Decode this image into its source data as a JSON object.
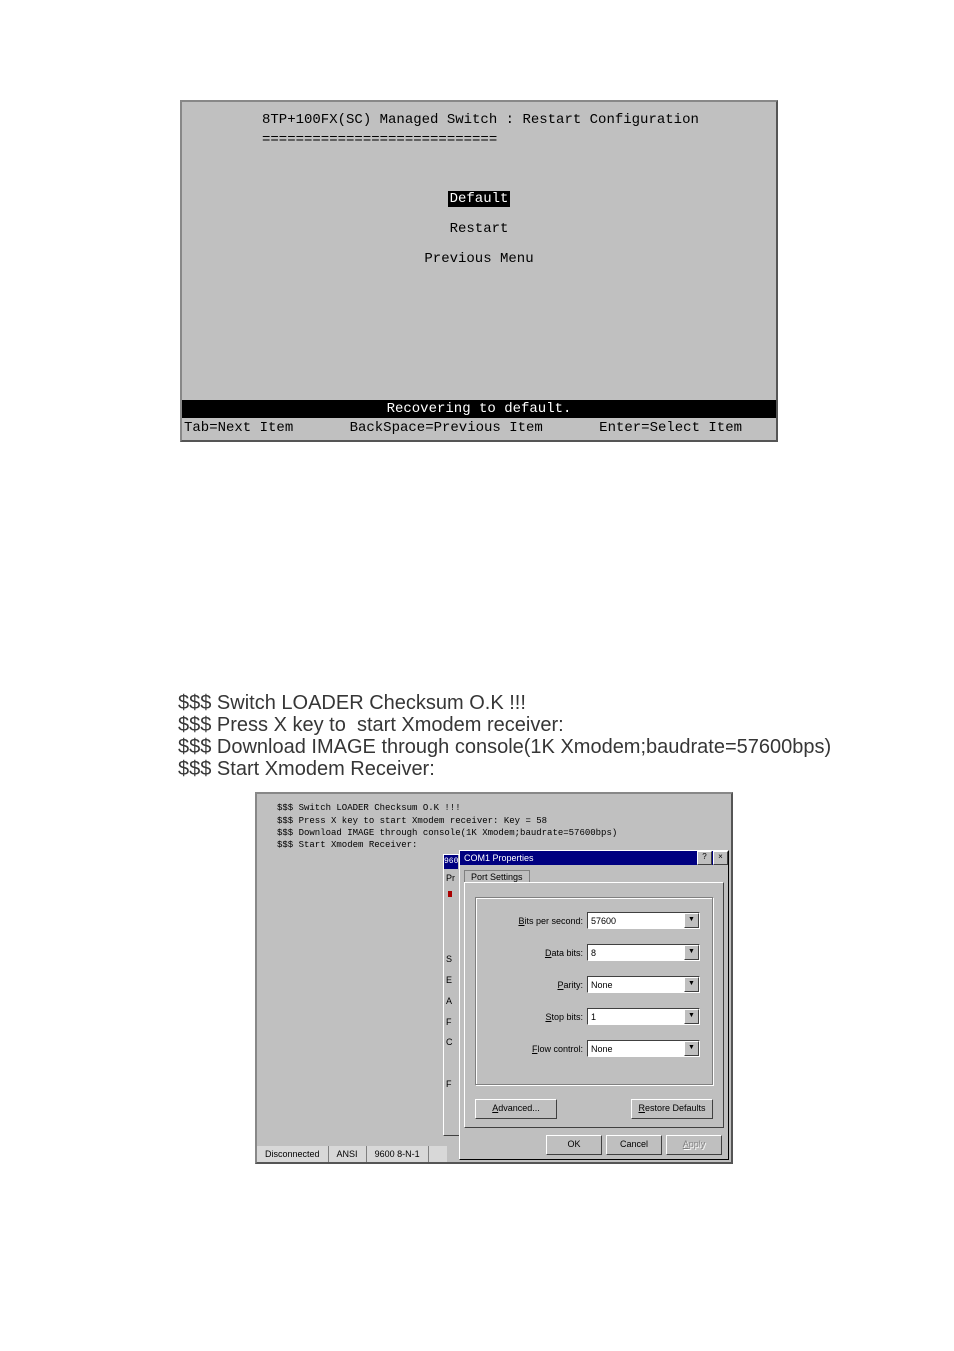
{
  "terminal1": {
    "title": "8TP+100FX(SC) Managed Switch : Restart Configuration",
    "underline": "============================",
    "menu": {
      "selected": "Default",
      "item2": "Restart",
      "item3": "Previous Menu"
    },
    "status": "Recovering to default.",
    "bottom": {
      "left": "Tab=Next Item",
      "mid": "BackSpace=Previous Item",
      "right": "Enter=Select Item"
    }
  },
  "mid_text": {
    "l1": "$$$ Switch LOADER Checksum O.K !!!",
    "l2": "$$$ Press X key to  start Xmodem receiver:",
    "l3": "$$$ Download IMAGE through console(1K Xmodem;baudrate=57600bps)",
    "l4": "$$$ Start Xmodem Receiver:"
  },
  "terminal2": {
    "lines": {
      "l1": "$$$ Switch LOADER Checksum O.K !!!",
      "l2": "$$$ Press X key to  start Xmodem receiver: Key = 58",
      "l3": "$$$ Download IMAGE through console(1K Xmodem;baudrate=57600bps)",
      "l4": "$$$ Start Xmodem Receiver:"
    },
    "hidden_win": {
      "pr": "Pr",
      "letters": "S\nE\nA\nF\nC\n\nF"
    },
    "status": {
      "c1": "Disconnected",
      "c2": "ANSI",
      "c3": "9600 8-N-1"
    }
  },
  "dialog": {
    "title": "COM1 Properties",
    "title_prefix": "960",
    "help_btn": "?",
    "close_btn": "×",
    "tab": "Port Settings",
    "fields": {
      "bits_per_second": {
        "label_u": "B",
        "label_rest": "its per second:",
        "value": "57600"
      },
      "data_bits": {
        "label_u": "D",
        "label_rest": "ata bits:",
        "value": "8"
      },
      "parity": {
        "label_u": "P",
        "label_rest": "arity:",
        "value": "None"
      },
      "stop_bits": {
        "label_u": "S",
        "label_rest": "top bits:",
        "value": "1"
      },
      "flow_control": {
        "label_u": "F",
        "label_rest": "low control:",
        "value": "None"
      }
    },
    "advanced_u": "A",
    "advanced_rest": "dvanced...",
    "restore_u": "R",
    "restore_rest": "estore Defaults",
    "ok": "OK",
    "cancel": "Cancel",
    "apply_u": "A",
    "apply_rest": "pply"
  }
}
